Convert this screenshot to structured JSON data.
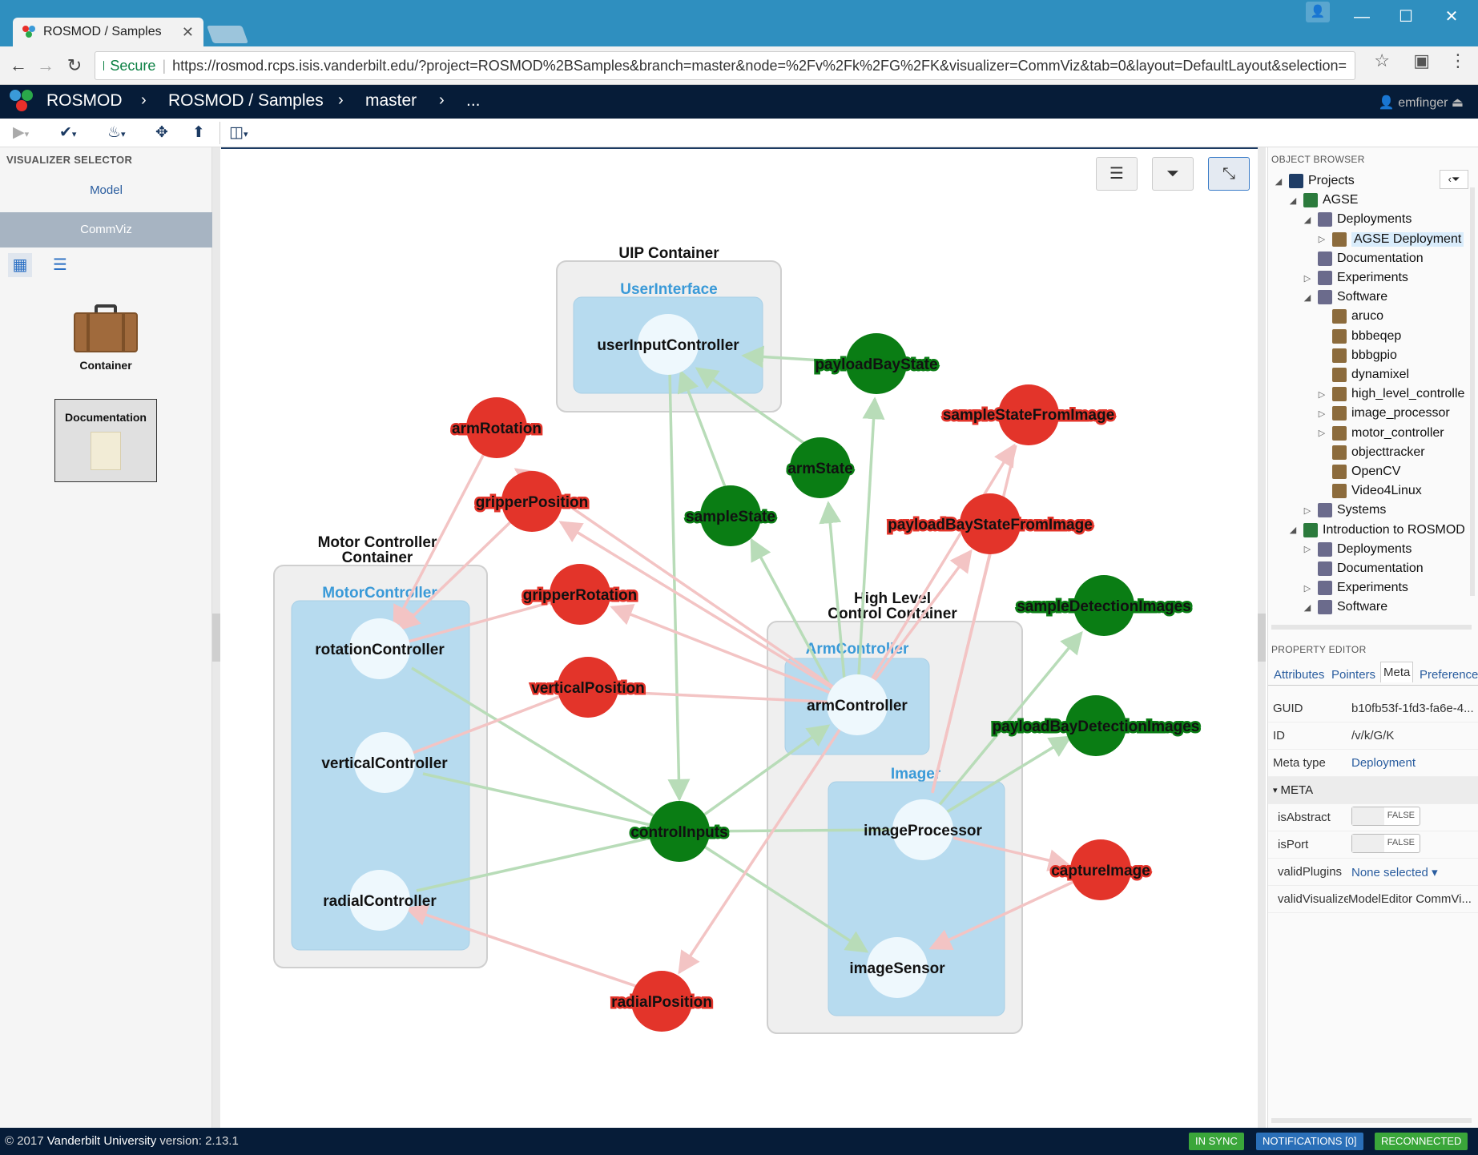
{
  "browser": {
    "tab_title": "ROSMOD / Samples",
    "secure_label": "Secure",
    "url": "https://rosmod.rcps.isis.vanderbilt.edu/?project=ROSMOD%2BSamples&branch=master&node=%2Fv%2Fk%2FG%2FK&visualizer=CommViz&tab=0&layout=DefaultLayout&selection="
  },
  "app": {
    "brand": "ROSMOD",
    "breadcrumbs": [
      "ROSMOD / Samples",
      "master",
      "..."
    ],
    "user": "emfinger"
  },
  "left": {
    "header": "VISUALIZER SELECTOR",
    "visualizers": [
      "Model",
      "CommViz"
    ],
    "active_visualizer": "CommViz",
    "decorators": [
      "Container",
      "Documentation"
    ]
  },
  "graph": {
    "containers": [
      {
        "title": "UIP Container",
        "component": "UserInterface"
      },
      {
        "title": "Motor Controller",
        "title2": "Container",
        "component": "MotorController"
      },
      {
        "title": "High Level",
        "title2": "Control Container",
        "component": "ArmController",
        "component2": "Imager"
      }
    ],
    "nodes": {
      "userInputController": "userInputController",
      "rotationController": "rotationController",
      "verticalController": "verticalController",
      "radialController": "radialController",
      "armController": "armController",
      "imageProcessor": "imageProcessor",
      "imageSensor": "imageSensor"
    },
    "topics_red": {
      "armRotation": "armRotation",
      "gripperPosition": "gripperPosition",
      "gripperRotation": "gripperRotation",
      "verticalPosition": "verticalPosition",
      "radialPosition": "radialPosition",
      "sampleStateFromImage": "sampleStateFromImage",
      "payloadBayStateFromImage": "payloadBayStateFromImage",
      "captureImage": "captureImage"
    },
    "topics_green": {
      "payloadBayState": "payloadBayState",
      "armState": "armState",
      "sampleState": "sampleState",
      "controlInputs": "controlInputs",
      "sampleDetectionImages": "sampleDetectionImages",
      "payloadBayDetectionImages": "payloadBayDetectionImages"
    },
    "colors": {
      "publish": "#e8302a",
      "subscribe": "#0a7d14",
      "container": "#efefef",
      "component": "#b7dbef"
    }
  },
  "right": {
    "object_browser_header": "OBJECT BROWSER",
    "tree": [
      {
        "label": "Projects",
        "depth": 0,
        "tw": "◢"
      },
      {
        "label": "AGSE",
        "depth": 1,
        "tw": "◢"
      },
      {
        "label": "Deployments",
        "depth": 2,
        "tw": "◢"
      },
      {
        "label": "AGSE Deployment",
        "depth": 3,
        "tw": "▷",
        "selected": true
      },
      {
        "label": "Documentation",
        "depth": 2,
        "tw": ""
      },
      {
        "label": "Experiments",
        "depth": 2,
        "tw": "▷"
      },
      {
        "label": "Software",
        "depth": 2,
        "tw": "◢"
      },
      {
        "label": "aruco",
        "depth": 3,
        "tw": ""
      },
      {
        "label": "bbbeqep",
        "depth": 3,
        "tw": ""
      },
      {
        "label": "bbbgpio",
        "depth": 3,
        "tw": ""
      },
      {
        "label": "dynamixel",
        "depth": 3,
        "tw": ""
      },
      {
        "label": "high_level_controlle",
        "depth": 3,
        "tw": "▷"
      },
      {
        "label": "image_processor",
        "depth": 3,
        "tw": "▷"
      },
      {
        "label": "motor_controller",
        "depth": 3,
        "tw": "▷"
      },
      {
        "label": "objecttracker",
        "depth": 3,
        "tw": ""
      },
      {
        "label": "OpenCV",
        "depth": 3,
        "tw": ""
      },
      {
        "label": "Video4Linux",
        "depth": 3,
        "tw": ""
      },
      {
        "label": "Systems",
        "depth": 2,
        "tw": "▷"
      },
      {
        "label": "Introduction to ROSMOD",
        "depth": 1,
        "tw": "◢"
      },
      {
        "label": "Deployments",
        "depth": 2,
        "tw": "▷"
      },
      {
        "label": "Documentation",
        "depth": 2,
        "tw": ""
      },
      {
        "label": "Experiments",
        "depth": 2,
        "tw": "▷"
      },
      {
        "label": "Software",
        "depth": 2,
        "tw": "◢"
      }
    ],
    "property_editor_header": "PROPERTY EDITOR",
    "tabs": [
      "Attributes",
      "Pointers",
      "Meta",
      "Preferences"
    ],
    "active_tab": "Meta",
    "props": {
      "guid_k": "GUID",
      "guid_v": "b10fb53f-1fd3-fa6e-4...",
      "id_k": "ID",
      "id_v": "/v/k/G/K",
      "meta_k": "Meta type",
      "meta_v": "Deployment",
      "section": "META",
      "abstract_k": "isAbstract",
      "abstract_v": "FALSE",
      "port_k": "isPort",
      "port_v": "FALSE",
      "plugins_k": "validPlugins",
      "plugins_v": "None selected",
      "vis_k": "validVisualizers",
      "vis_v": "ModelEditor CommVi..."
    }
  },
  "footer": {
    "copyright": "© 2017",
    "org": "Vanderbilt University",
    "version_label": "version:",
    "version": "2.13.1",
    "sync": "IN SYNC",
    "notifications": "NOTIFICATIONS [0]",
    "reconnected": "RECONNECTED"
  }
}
